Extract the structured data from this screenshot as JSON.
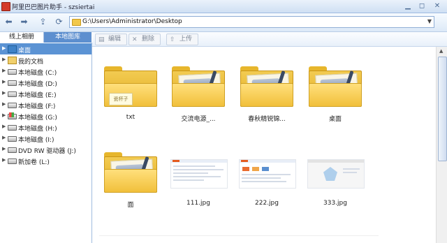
{
  "window": {
    "title": "阿里巴巴图片助手 - szsiertai"
  },
  "address_bar": {
    "path": "G:\\Users\\Administrator\\Desktop"
  },
  "sidebar": {
    "tabs": [
      {
        "label": "线上相册",
        "active": false
      },
      {
        "label": "本地图库",
        "active": true
      }
    ],
    "tree": [
      {
        "label": "桌面",
        "icon": "desktop-icon",
        "selected": true
      },
      {
        "label": "我的文档",
        "icon": "documents-icon",
        "selected": false
      },
      {
        "label": "本地磁盘 (C:)",
        "icon": "drive-icon",
        "selected": false
      },
      {
        "label": "本地磁盘 (D:)",
        "icon": "drive-icon",
        "selected": false
      },
      {
        "label": "本地磁盘 (E:)",
        "icon": "drive-icon",
        "selected": false
      },
      {
        "label": "本地磁盘 (F:)",
        "icon": "drive-icon",
        "selected": false
      },
      {
        "label": "本地磁盘 (G:)",
        "icon": "system-drive-icon",
        "selected": false
      },
      {
        "label": "本地磁盘 (H:)",
        "icon": "drive-icon",
        "selected": false
      },
      {
        "label": "本地磁盘 (I:)",
        "icon": "drive-icon",
        "selected": false
      },
      {
        "label": "DVD RW 驱动器 (J:)",
        "icon": "dvd-drive-icon",
        "selected": false
      },
      {
        "label": "新加卷 (L:)",
        "icon": "drive-icon",
        "selected": false
      }
    ]
  },
  "toolbar": {
    "edit_label": "编辑",
    "delete_label": "删除",
    "upload_label": "上传",
    "enabled": false
  },
  "files": [
    {
      "name": "txt",
      "type": "folder",
      "variant": "sticky",
      "sticky_text": "瓷杯子"
    },
    {
      "name": "交流电源_...",
      "type": "folder",
      "variant": "photo"
    },
    {
      "name": "春秋精锐锦...",
      "type": "folder",
      "variant": "photo"
    },
    {
      "name": "桌面",
      "type": "folder",
      "variant": "photo"
    },
    {
      "name": "面",
      "type": "folder",
      "variant": "photo"
    },
    {
      "name": "111.jpg",
      "type": "image",
      "variant": "webpage"
    },
    {
      "name": "222.jpg",
      "type": "image",
      "variant": "webpage-grid"
    },
    {
      "name": "333.jpg",
      "type": "image",
      "variant": "radar-chart"
    }
  ],
  "colors": {
    "selection": "#5b93d4",
    "active_tab": "#5d8fcf",
    "folder": "#f1c03b"
  }
}
